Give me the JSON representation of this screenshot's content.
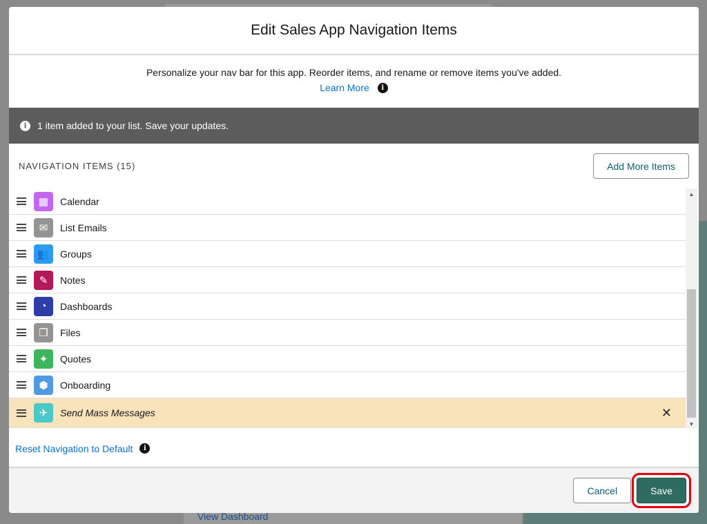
{
  "background": {
    "link": "View Dashboard"
  },
  "modal": {
    "title": "Edit Sales App Navigation Items",
    "description": "Personalize your nav bar for this app. Reorder items, and rename or remove items you've added.",
    "learn_more": "Learn More",
    "toast": "1 item added to your list. Save your updates.",
    "section_title": "NAVIGATION ITEMS (15)",
    "add_more": "Add More Items",
    "items": [
      {
        "label": "Calendar",
        "icon": "calendar-icon",
        "color": "#c466f0",
        "glyph": "▦"
      },
      {
        "label": "List Emails",
        "icon": "list-emails-icon",
        "color": "#969492",
        "glyph": "✉"
      },
      {
        "label": "Groups",
        "icon": "groups-icon",
        "color": "#2f9bf0",
        "glyph": "👥"
      },
      {
        "label": "Notes",
        "icon": "notes-icon",
        "color": "#b3185a",
        "glyph": "✎"
      },
      {
        "label": "Dashboards",
        "icon": "dashboards-icon",
        "color": "#2d3ea8",
        "glyph": "◔"
      },
      {
        "label": "Files",
        "icon": "files-icon",
        "color": "#969492",
        "glyph": "❐"
      },
      {
        "label": "Quotes",
        "icon": "quotes-icon",
        "color": "#3fb55b",
        "glyph": "✦"
      },
      {
        "label": "Onboarding",
        "icon": "onboarding-icon",
        "color": "#4f9ae0",
        "glyph": "⬢"
      },
      {
        "label": "Send Mass Messages",
        "icon": "send-mass-messages-icon",
        "color": "#4bc9c9",
        "glyph": "✈",
        "highlighted": true
      }
    ],
    "remove_glyph": "✕",
    "reset": "Reset Navigation to Default",
    "cancel": "Cancel",
    "save": "Save"
  }
}
